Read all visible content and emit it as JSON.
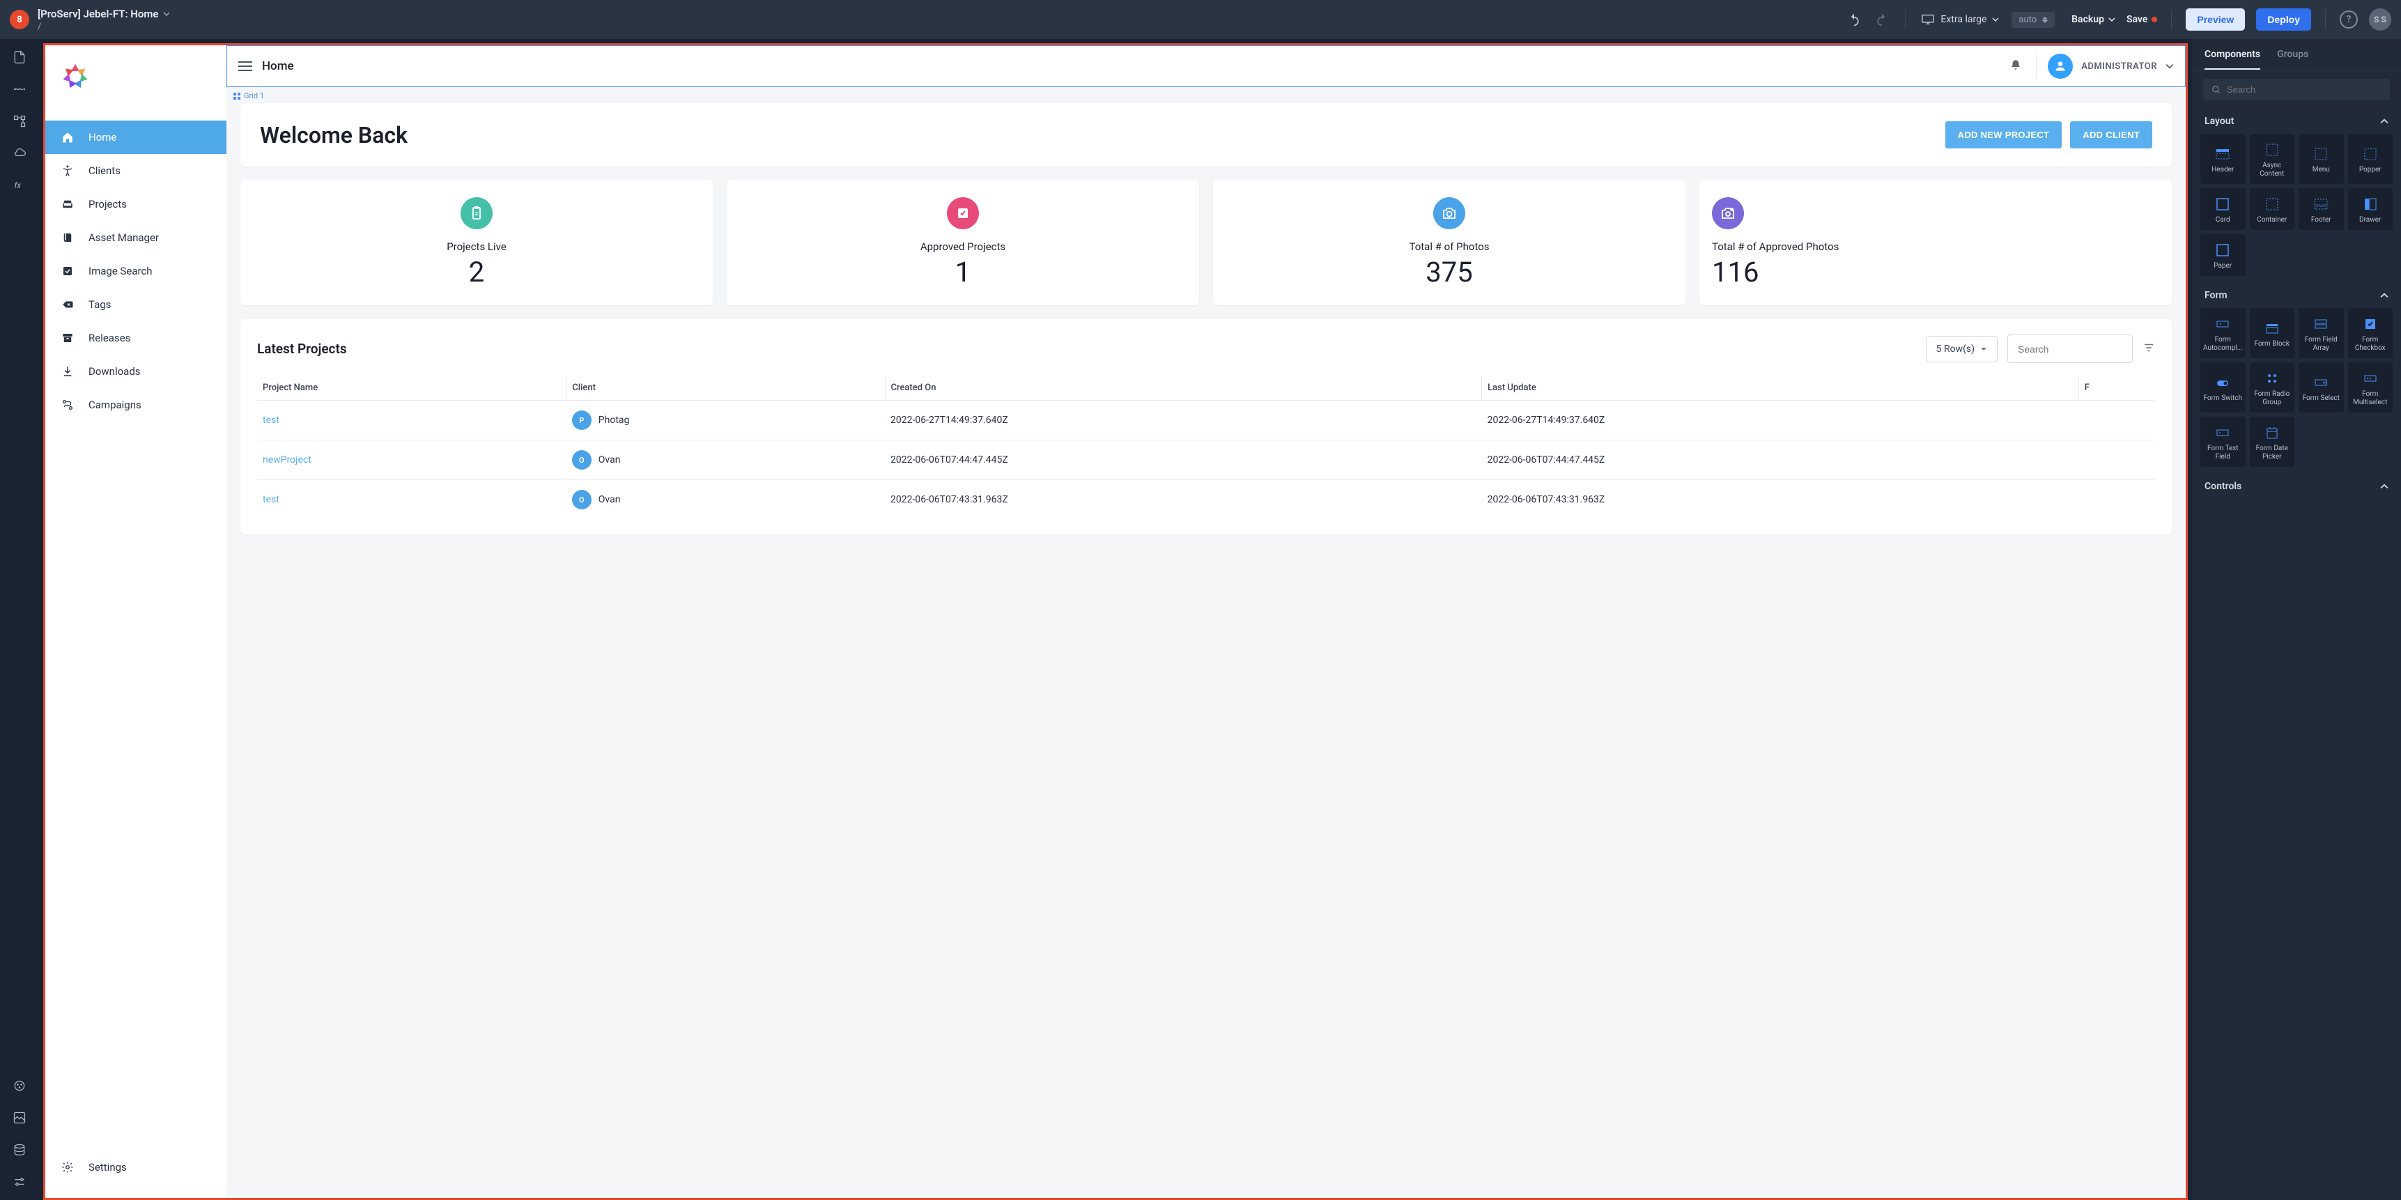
{
  "topbar": {
    "logo_text": "8",
    "project_title": "[ProServ] Jebel-FT: Home",
    "project_path": "/",
    "viewport": "Extra large",
    "size_value": "auto",
    "backup": "Backup",
    "save": "Save",
    "preview": "Preview",
    "deploy": "Deploy",
    "avatar": "S S"
  },
  "app": {
    "header_title": "Home",
    "user_role": "ADMINISTRATOR",
    "grid_label": "Grid 1",
    "nav": [
      {
        "label": "Home",
        "icon": "home"
      },
      {
        "label": "Clients",
        "icon": "accessibility"
      },
      {
        "label": "Projects",
        "icon": "lounge"
      },
      {
        "label": "Asset Manager",
        "icon": "book"
      },
      {
        "label": "Image Search",
        "icon": "inventory"
      },
      {
        "label": "Tags",
        "icon": "backspace"
      },
      {
        "label": "Releases",
        "icon": "archive"
      },
      {
        "label": "Downloads",
        "icon": "download"
      },
      {
        "label": "Campaigns",
        "icon": "route"
      }
    ],
    "nav_footer": {
      "label": "Settings",
      "icon": "gear"
    },
    "welcome": {
      "title": "Welcome Back",
      "btn_add_project": "ADD NEW PROJECT",
      "btn_add_client": "ADD CLIENT"
    },
    "stats": [
      {
        "label": "Projects Live",
        "value": "2",
        "icon": "clipboard",
        "color": "#44c0a8"
      },
      {
        "label": "Approved Projects",
        "value": "1",
        "icon": "checkbox",
        "color": "#e84a7a"
      },
      {
        "label": "Total # of Photos",
        "value": "375",
        "icon": "camera",
        "color": "#4aa3e8"
      },
      {
        "label": "Total # of Approved Photos",
        "value": "116",
        "icon": "add-photo",
        "color": "#7a6ad9"
      }
    ],
    "latest": {
      "title": "Latest Projects",
      "rows_select": "5 Row(s)",
      "search_placeholder": "Search",
      "columns": [
        "Project Name",
        "Client",
        "Created On",
        "Last Update",
        "F"
      ],
      "rows": [
        {
          "project": "test",
          "client_initial": "P",
          "client": "Photag",
          "client_color": "#4aa3e8",
          "created": "2022-06-27T14:49:37.640Z",
          "updated": "2022-06-27T14:49:37.640Z"
        },
        {
          "project": "newProject",
          "client_initial": "O",
          "client": "Ovan",
          "client_color": "#4aa3e8",
          "created": "2022-06-06T07:44:47.445Z",
          "updated": "2022-06-06T07:44:47.445Z"
        },
        {
          "project": "test",
          "client_initial": "O",
          "client": "Ovan",
          "client_color": "#4aa3e8",
          "created": "2022-06-06T07:43:31.963Z",
          "updated": "2022-06-06T07:43:31.963Z"
        }
      ]
    }
  },
  "panel": {
    "tab_components": "Components",
    "tab_groups": "Groups",
    "search_placeholder": "Search",
    "sections": {
      "layout_title": "Layout",
      "layout": [
        "Header",
        "Async Content",
        "Menu",
        "Popper",
        "Card",
        "Container",
        "Footer",
        "Drawer",
        "Paper"
      ],
      "form_title": "Form",
      "form": [
        "Form Autocompl...",
        "Form Block",
        "Form Field Array",
        "Form Checkbox",
        "Form Switch",
        "Form Radio Group",
        "Form Select",
        "Form Multiselect",
        "Form Text Field",
        "Form Date Picker"
      ],
      "controls_title": "Controls"
    }
  }
}
